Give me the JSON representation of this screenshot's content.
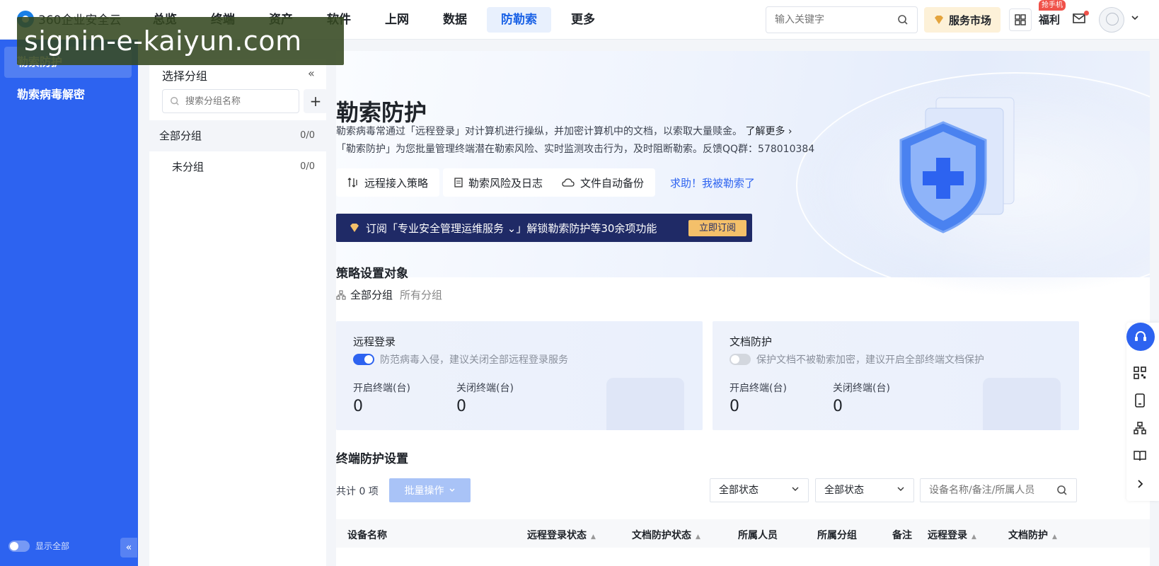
{
  "brand": {
    "name": "360企业安全云"
  },
  "nav": {
    "items": [
      "总览",
      "终端",
      "资产",
      "软件",
      "上网",
      "数据",
      "防勒索",
      "更多"
    ],
    "active_index": 6
  },
  "header": {
    "search_placeholder": "输入关键字",
    "market_label": "服务市场",
    "welfare_label": "福利",
    "welfare_tag": "抢手机"
  },
  "watermark": {
    "text": "signin-e-kaiyun.com"
  },
  "sidebar": {
    "items": [
      {
        "label": "勒索防护",
        "active": true
      },
      {
        "label": "勒索病毒解密",
        "active": false
      }
    ],
    "show_all_label": "显示全部"
  },
  "groups": {
    "title": "选择分组",
    "search_placeholder": "搜索分组名称",
    "rows": [
      {
        "label": "全部分组",
        "count": "0/0"
      },
      {
        "label": "未分组",
        "count": "0/0"
      }
    ]
  },
  "hero": {
    "title": "勒索防护",
    "line1": "勒索病毒常通过「远程登录」对计算机进行操纵，并加密计算机中的文档，以索取大量赎金。",
    "learn_more": "了解更多 ›",
    "line2": "「勒索防护」为您批量管理终端潜在勒索风险、实时监测攻击行为，及时阻断勒索。反馈QQ群：578010384",
    "buttons": [
      "远程接入策略",
      "勒索风险及日志",
      "文件自动备份"
    ],
    "help_link": "求助！我被勒索了",
    "banner_text": "订阅「专业安全管理运维服务 ⌄」解锁勒索防护等30余项功能",
    "banner_button": "立即订阅"
  },
  "policy": {
    "title": "策略设置对象",
    "target": "全部分组",
    "target_note": "所有分组"
  },
  "cards": [
    {
      "title": "远程登录",
      "switch_on": true,
      "desc": "防范病毒入侵，建议关闭全部远程登录服务",
      "on_label": "开启终端(台)",
      "on_value": "0",
      "off_label": "关闭终端(台)",
      "off_value": "0"
    },
    {
      "title": "文档防护",
      "switch_on": false,
      "desc": "保护文档不被勒索加密，建议开启全部终端文档保护",
      "on_label": "开启终端(台)",
      "on_value": "0",
      "off_label": "关闭终端(台)",
      "off_value": "0"
    }
  ],
  "terminal": {
    "title": "终端防护设置",
    "total": "共计 0 项",
    "batch_label": "批量操作",
    "filter1": "全部状态",
    "filter2": "全部状态",
    "search_placeholder": "设备名称/备注/所属人员",
    "columns": [
      "设备名称",
      "远程登录状态",
      "文档防护状态",
      "所属人员",
      "所属分组",
      "备注",
      "远程登录",
      "文档防护"
    ]
  },
  "colors": {
    "primary": "#2d63f0",
    "sidebar": "#2d63f0",
    "banner": "#1f2a66",
    "banner_button": "#f4c06a",
    "nav_active_bg": "#e8f0fd"
  }
}
